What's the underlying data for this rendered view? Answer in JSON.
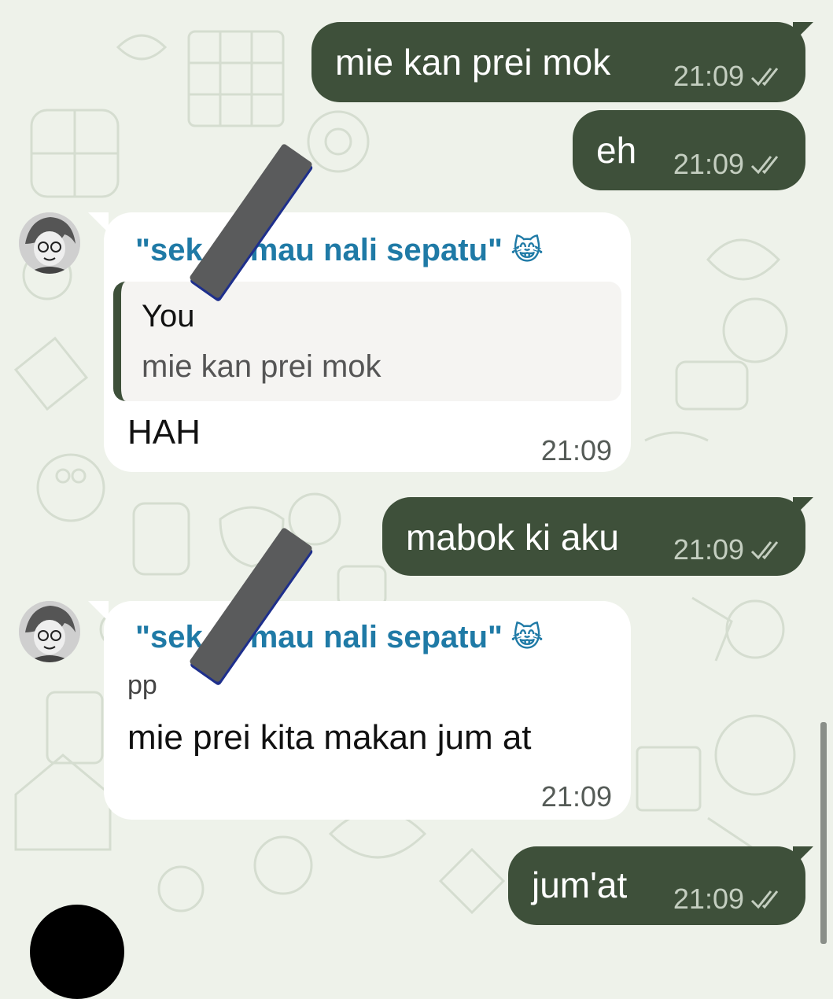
{
  "colors": {
    "outgoing_bubble": "#3e503a",
    "incoming_bubble": "#ffffff",
    "sender_name": "#1f7aa6",
    "wallpaper": "#eef2ea"
  },
  "messages": {
    "m1": {
      "text": "mie kan prei mok",
      "time": "21:09",
      "status_icon": "double-check-icon"
    },
    "m2": {
      "text": "eh",
      "time": "21:09",
      "status_icon": "double-check-icon"
    },
    "m3": {
      "sender_prefix": "\"sek",
      "sender_suffix": "mau nali sepatu\"",
      "sender_emoji": "😹",
      "quote_author": "You",
      "quote_text": "mie kan prei mok",
      "text": "HAH",
      "time": "21:09"
    },
    "m4": {
      "text": "mabok ki aku",
      "time": "21:09",
      "status_icon": "double-check-icon"
    },
    "m5": {
      "sender_prefix": "\"sek",
      "sender_suffix": "mau nali sepatu\"",
      "sender_emoji": "😹",
      "pushname": "pp",
      "text": "mie prei kita makan jum at",
      "time": "21:09"
    },
    "m6": {
      "text": "jum'at",
      "time": "21:09",
      "status_icon": "double-check-icon"
    }
  }
}
